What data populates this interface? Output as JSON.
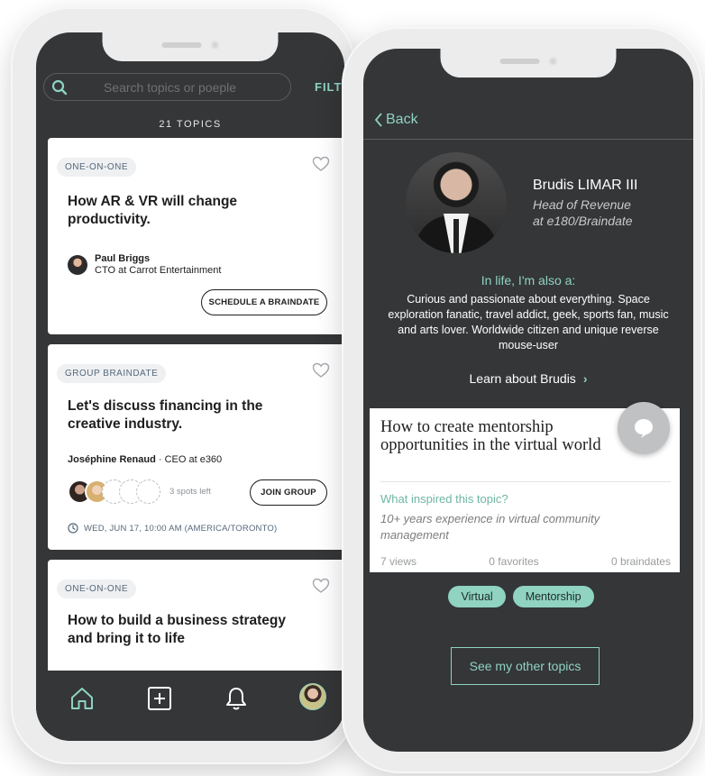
{
  "left_screen": {
    "search": {
      "placeholder": "Search topics or poeple",
      "filter_label": "FILT"
    },
    "topics_count": "21 TOPICS",
    "cards": [
      {
        "type": "ONE-ON-ONE",
        "title": "How AR & VR will change productivity.",
        "author_name": "Paul Briggs",
        "author_role": "CTO at Carrot Entertainment",
        "action": "SCHEDULE A BRAINDATE"
      },
      {
        "type": "GROUP BRAINDATE",
        "title": "Let's discuss financing in the creative industry.",
        "host_name": "Joséphine Renaud",
        "host_role": "· CEO at e360",
        "spots_left": "3 spots left",
        "action": "JOIN GROUP",
        "date": "WED, JUN 17, 10:00 AM (AMERICA/TORONTO)"
      },
      {
        "type": "ONE-ON-ONE",
        "title": "How to build a business strategy and bring it to life"
      }
    ],
    "tabs": [
      "home-icon",
      "add-icon",
      "bell-icon",
      "profile-avatar"
    ]
  },
  "right_screen": {
    "back_label": "Back",
    "profile": {
      "name": "Brudis LIMAR III",
      "title_line1": "Head of Revenue",
      "title_line2": "at e180/Braindate"
    },
    "also_heading": "In life, I'm also a:",
    "also_text": "Curious and passionate about everything. Space exploration fanatic, travel addict, geek, sports fan, music and arts lover. Worldwide citizen and unique reverse mouse-user",
    "learn_more": "Learn about Brudis",
    "topic": {
      "title": "How to create mentorship opportunities in the virtual world",
      "inspired_label": "What inspired this topic?",
      "inspired_text": "10+ years experience in virtual community management",
      "views": "7 views",
      "favorites": "0 favorites",
      "braindates": "0 braindates"
    },
    "tags": [
      "Virtual",
      "Mentorship"
    ],
    "other_topics_button": "See my other topics"
  },
  "colors": {
    "accent": "#8fd3c0",
    "screen_bg": "#343638",
    "card_bg": "#ffffff"
  }
}
